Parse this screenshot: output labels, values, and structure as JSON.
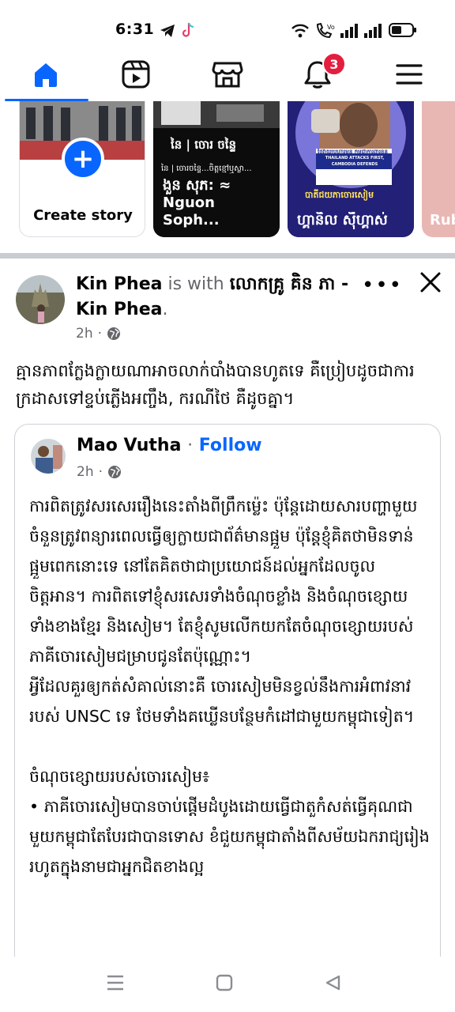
{
  "status_bar": {
    "time": "6:31",
    "icons": [
      "telegram-icon",
      "tiktok-icon",
      "wifi-icon",
      "call-icon",
      "signal-icon",
      "signal-icon",
      "battery-icon"
    ]
  },
  "nav": {
    "items": [
      "home-icon",
      "video-icon",
      "marketplace-icon",
      "notifications-icon",
      "menu-icon"
    ],
    "active": "home",
    "notification_count": "3",
    "accent": "#0866ff",
    "badge_color": "#e41e3f"
  },
  "stories": {
    "create_label": "Create story",
    "items": [
      {
        "name": "ងួន សុភ: ≈ Nguon Soph...",
        "title": "នៃ | ចោរ ចន្ទៃ",
        "subtitle": "នៃ | ចោរចន្ទៃ...ចិត្តខ្មៅឬស្លា..."
      },
      {
        "name": "ហ្គានិល ស៊ីហ្គាស់",
        "banner": "ថៃវាយប្រហារមុន កម្ពុជាការពារខ្លួន",
        "banner_en": "THAILAND ATTACKS FIRST, CAMBODIA DEFENDS",
        "caption": "បាតីជយភាចោរសៀម"
      },
      {
        "name": "Rub"
      }
    ]
  },
  "post": {
    "author": "Kin Phea",
    "with_text": "is with",
    "with_name": "លោកគ្រូ គិន ភា - Kin Phea",
    "time": "2h",
    "text": "គ្មានភាពក្លែងក្លាយណាអាចលាក់បាំងបានហូតទេ គឺប្រៀបដូចជាការក្រដាសទៅខ្ទប់ភ្លើងអញ្ចឹង, ករណីថៃ គឺដូចគ្នា។"
  },
  "shared": {
    "author": "Mao Vutha",
    "separator": "·",
    "follow_label": "Follow",
    "time": "2h",
    "body": "ការពិតត្រូវសរសេររឿងនេះតាំងពីព្រឹកម្ល៉េះ ប៉ុន្តែដោយសារបញ្ហាមួយចំនួនត្រូវពន្យារពេលធ្វើឲ្យក្លាយជាព័ត៌មានផ្អួម ប៉ុន្តែខ្ញុំគិតថាមិនទាន់ផ្អួមពេកនោះទេ នៅតែគិតថាជាប្រយោជន៍ដល់អ្នកដែលចូលចិត្តអាន។ ការពិតទៅខ្ញុំសរសេរទាំងចំណុចខ្លាំង និងចំណុចខ្សោយទាំងខាងខ្មែរ និងសៀម។ តែខ្ញុំសូមលើកយកតែចំណុចខ្សោយរបស់ភាគីចោរសៀមជម្រាបជូនតែប៉ុណ្ណោះ។\nអ្វីដែលគួរឲ្យកត់សំគាល់នោះគឺ ចោរសៀមមិនខ្វល់នឹងការអំពាវនាវរបស់ UNSC ទេ ថែមទាំងគឃ្លើនបន្ថែមកំដៅជាមួយកម្ពុជាទៀត។\n\nចំណុចខ្សោយរបស់ចោរសៀម៖\n• ភាគីចោរសៀមបានចាប់ផ្តើមដំបូងដោយធ្វើជាតួកំសត់ធ្វើគុណជាមួយកម្ពុជាតែបែរជាបានទោស ខំជួយកម្ពុជាតាំងពីសម័យឯករាជ្យរៀងរហូតក្នុងនាមជាអ្នកជិតខាងល្អ"
  },
  "system_nav": [
    "recent-apps-icon",
    "home-button-icon",
    "back-icon"
  ]
}
